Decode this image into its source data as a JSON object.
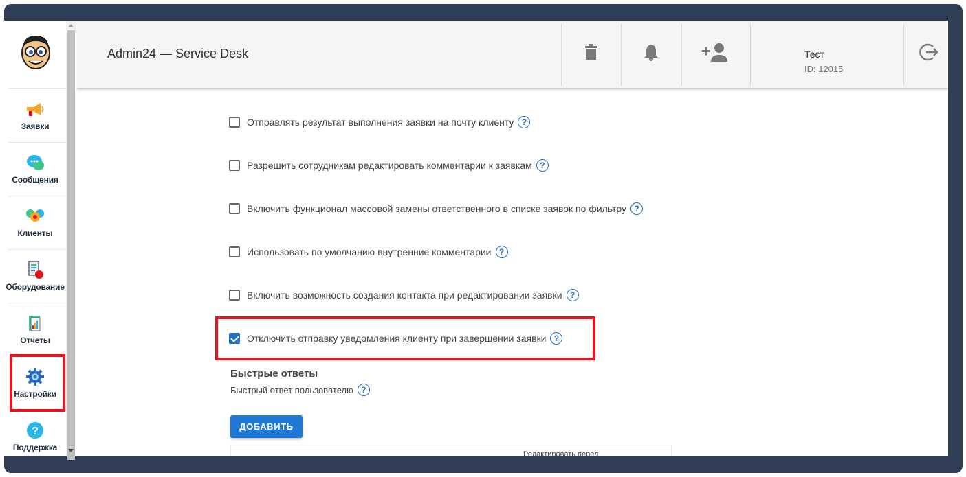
{
  "app": {
    "title": "Admin24 — Service Desk"
  },
  "user": {
    "name": "Тест",
    "id": "ID: 12015"
  },
  "topbar": {
    "icons": [
      "trash-icon",
      "bell-icon",
      "add-user-icon",
      "logout-icon"
    ]
  },
  "sidebar": {
    "items": [
      {
        "label": "Заявки",
        "icon": "megaphone-icon"
      },
      {
        "label": "Сообщения",
        "icon": "chat-icon"
      },
      {
        "label": "Клиенты",
        "icon": "clients-icon"
      },
      {
        "label": "Оборудование",
        "icon": "equipment-icon"
      },
      {
        "label": "Отчеты",
        "icon": "reports-icon"
      },
      {
        "label": "Настройки",
        "icon": "gear-icon"
      },
      {
        "label": "Поддержка",
        "icon": "help-icon"
      }
    ]
  },
  "options": [
    {
      "label": "Отправлять результат выполнения заявки на почту клиенту",
      "checked": false
    },
    {
      "label": "Разрешить сотрудникам редактировать комментарии к заявкам",
      "checked": false
    },
    {
      "label": "Включить функционал массовой замены ответственного в списке заявок по фильтру",
      "checked": false
    },
    {
      "label": "Использовать по умолчанию внутренние комментарии",
      "checked": false
    },
    {
      "label": "Включить возможность создания контакта при редактировании заявки",
      "checked": false
    },
    {
      "label": "Отключить отправку уведомления клиенту при завершении заявки",
      "checked": true
    }
  ],
  "quick_replies": {
    "title": "Быстрые ответы",
    "subtitle": "Быстрый ответ пользователю",
    "add_label": "ДОБАВИТЬ",
    "table_header_partial": "Редактировать перед"
  },
  "help_glyph": "?",
  "colors": {
    "frame": "#2f3d55",
    "accent": "#1f6fc5",
    "highlight": "#e8131c",
    "button": "#1f79d4"
  }
}
